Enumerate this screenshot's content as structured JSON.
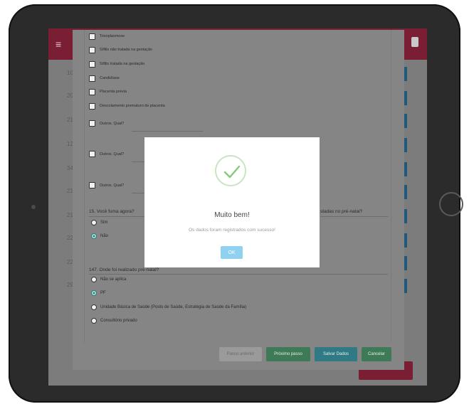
{
  "form": {
    "checkboxes": [
      "Toxoplasmose",
      "Sífilis não tratada na gestação",
      "Sífilis tratada na gestação",
      "Candidíase",
      "Placenta prévia",
      "Descolamento prematuro de placenta",
      "Outros. Qual?",
      "Outros. Qual?",
      "Outros. Qual?"
    ],
    "q15": {
      "title": "15. Você fuma agora?",
      "options": [
        "Sim",
        "Não"
      ],
      "selected": "Não"
    },
    "partial_question_right": "stadas no pré-natal?",
    "q147": {
      "title": "147. Onde foi realizado pré-natal?",
      "options": [
        "Não se aplica",
        "PF",
        "Unidade Básica de Saúde (Posto de Saúde, Estratégia de Saúde da Família)",
        "Consultório privado"
      ],
      "selected": "PF"
    },
    "buttons": {
      "previous": "Passo anterior",
      "next": "Próximo passo",
      "save": "Salvar Dados",
      "cancel": "Cancelar"
    },
    "button_colors": {
      "previous": "#9a9a9a",
      "next": "#3d7a55",
      "save": "#2f7a84",
      "cancel": "#3d7a55"
    }
  },
  "modal": {
    "title": "Muito bem!",
    "message": "Os dados foram registrados com sucesso!",
    "ok_label": "OK",
    "icon": "success-check-icon",
    "accent_color": "#8fd1ef"
  },
  "app": {
    "bar_color": "#7a1f33",
    "background_numbers": [
      "10",
      "20",
      "21",
      "12",
      "34",
      "21",
      "21",
      "22",
      "22",
      "29"
    ]
  }
}
